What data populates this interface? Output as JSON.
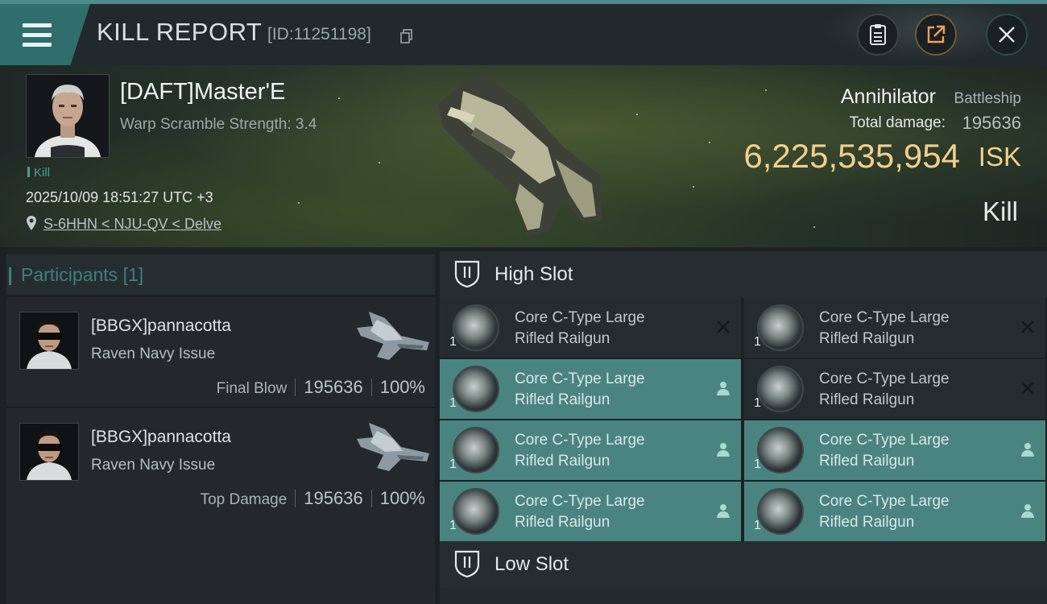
{
  "header": {
    "menu_icon": "menu-icon",
    "title": "KILL REPORT",
    "report_id": "[ID:11251198]",
    "buttons": [
      "clipboard-icon",
      "share-icon",
      "close-icon"
    ]
  },
  "victim": {
    "name": "[DAFT]Master'E",
    "warp_scramble": "Warp Scramble Strength: 3.4",
    "tag": "Kill",
    "datetime": "2025/10/09 18:51:27 UTC +3",
    "location": "S-6HHN < NJU-QV < Delve",
    "ship_name": "Annihilator",
    "ship_class": "Battleship",
    "total_damage_label": "Total damage:",
    "total_damage": "195636",
    "isk_value": "6,225,535,954",
    "isk_unit": "ISK",
    "status": "Kill"
  },
  "participants": {
    "label": "Participants",
    "count": "[1]",
    "items": [
      {
        "name": "[BBGX]pannacotta",
        "ship": "Raven Navy Issue",
        "role": "Final Blow",
        "damage": "195636",
        "percent": "100%"
      },
      {
        "name": "[BBGX]pannacotta",
        "ship": "Raven Navy Issue",
        "role": "Top Damage",
        "damage": "195636",
        "percent": "100%"
      }
    ]
  },
  "high_slot": {
    "label": "High Slot",
    "modules": [
      {
        "line1": "Core C-Type Large",
        "line2": "Rifled Railgun",
        "qty": "1",
        "state": "destroyed",
        "active": false
      },
      {
        "line1": "Core C-Type Large",
        "line2": "Rifled Railgun",
        "qty": "1",
        "state": "destroyed",
        "active": false
      },
      {
        "line1": "Core C-Type Large",
        "line2": "Rifled Railgun",
        "qty": "1",
        "state": "dropped",
        "active": true
      },
      {
        "line1": "Core C-Type Large",
        "line2": "Rifled Railgun",
        "qty": "1",
        "state": "destroyed",
        "active": false
      },
      {
        "line1": "Core C-Type Large",
        "line2": "Rifled Railgun",
        "qty": "1",
        "state": "dropped",
        "active": true
      },
      {
        "line1": "Core C-Type Large",
        "line2": "Rifled Railgun",
        "qty": "1",
        "state": "dropped",
        "active": true
      },
      {
        "line1": "Core C-Type Large",
        "line2": "Rifled Railgun",
        "qty": "1",
        "state": "dropped",
        "active": true
      },
      {
        "line1": "Core C-Type Large",
        "line2": "Rifled Railgun",
        "qty": "1",
        "state": "dropped",
        "active": true
      }
    ]
  },
  "low_slot": {
    "label": "Low Slot"
  },
  "colors": {
    "accent": "#4a8480",
    "isk": "#f1cf8c",
    "panel": "#252c2f"
  }
}
